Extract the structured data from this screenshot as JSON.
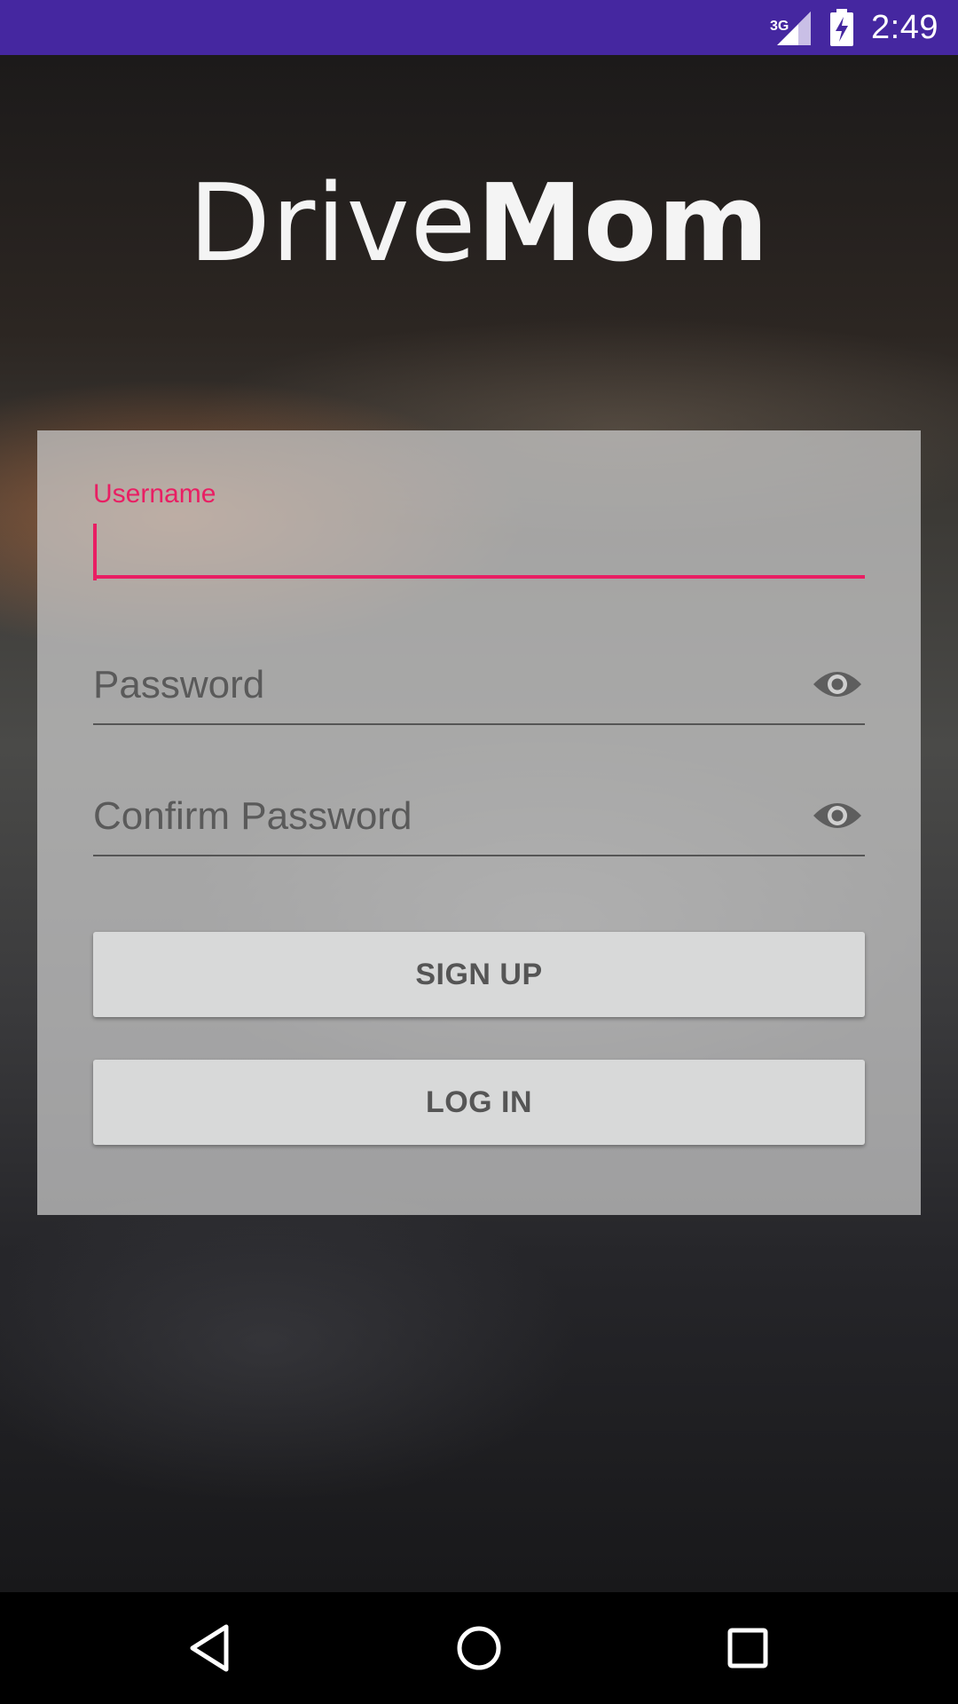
{
  "status_bar": {
    "network": "3G",
    "time": "2:49",
    "color": "#4527a0",
    "icons": [
      "signal-icon",
      "battery-charging-icon"
    ]
  },
  "app": {
    "logo_light": "Drive",
    "logo_bold": "Mom"
  },
  "form": {
    "username_label": "Username",
    "username_value": "",
    "password_placeholder": "Password",
    "confirm_password_placeholder": "Confirm Password",
    "visibility_icon": "eye-icon",
    "accent_color": "#e91e63"
  },
  "buttons": {
    "signup_label": "SIGN UP",
    "login_label": "LOG IN"
  },
  "nav_bar": {
    "icons": [
      "back-icon",
      "home-icon",
      "recents-icon"
    ]
  }
}
